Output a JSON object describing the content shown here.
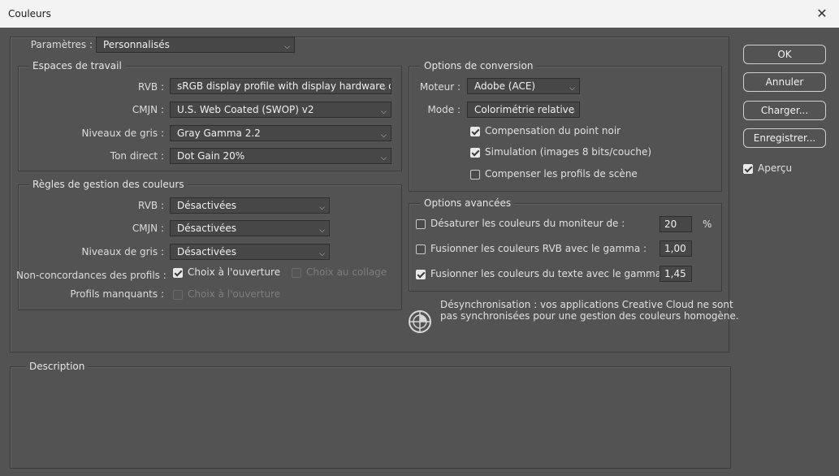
{
  "window": {
    "title": "Couleurs",
    "close_icon": "close-icon"
  },
  "settings": {
    "label": "Paramètres :",
    "value": "Personnalisés"
  },
  "workspaces": {
    "legend": "Espaces de travail",
    "rows": [
      {
        "label": "RVB :",
        "value": "sRGB display profile with display hardware c..."
      },
      {
        "label": "CMJN :",
        "value": "U.S. Web Coated (SWOP) v2"
      },
      {
        "label": "Niveaux de gris :",
        "value": "Gray Gamma 2.2"
      },
      {
        "label": "Ton direct :",
        "value": "Dot Gain 20%"
      }
    ]
  },
  "policies": {
    "legend": "Règles de gestion des couleurs",
    "rows": [
      {
        "label": "RVB :",
        "value": "Désactivées"
      },
      {
        "label": "CMJN :",
        "value": "Désactivées"
      },
      {
        "label": "Niveaux de gris :",
        "value": "Désactivées"
      }
    ],
    "mismatch_label": "Non-concordances des profils :",
    "mismatch_open": {
      "label": "Choix à l'ouverture",
      "checked": true
    },
    "mismatch_paste": {
      "label": "Choix au collage",
      "checked": false,
      "disabled": true
    },
    "missing_label": "Profils manquants :",
    "missing_open": {
      "label": "Choix à l'ouverture",
      "checked": false,
      "disabled": true
    }
  },
  "conversion": {
    "legend": "Options de conversion",
    "engine_label": "Moteur :",
    "engine_value": "Adobe (ACE)",
    "intent_label": "Mode :",
    "intent_value": "Colorimétrie relative",
    "black_point": {
      "label": "Compensation du point noir",
      "checked": true
    },
    "dither": {
      "label": "Simulation (images 8 bits/couche)",
      "checked": true
    },
    "scene_profiles": {
      "label": "Compenser les profils de scène",
      "checked": false
    }
  },
  "advanced": {
    "legend": "Options avancées",
    "desaturate": {
      "label": "Désaturer les couleurs du moniteur de :",
      "value": "20",
      "unit": "%",
      "checked": false
    },
    "blend_rgb": {
      "label": "Fusionner les couleurs RVB avec le gamma :",
      "value": "1,00",
      "checked": false
    },
    "blend_text": {
      "label": "Fusionner les couleurs du texte avec le gamma :",
      "value": "1,45",
      "checked": true
    }
  },
  "sync_message": {
    "line1": "Désynchronisation : vos applications Creative Cloud ne sont",
    "line2": "pas synchronisées pour une gestion des couleurs homogène.",
    "icon": "sync-status-icon"
  },
  "description": {
    "legend": "Description"
  },
  "buttons": {
    "ok": "OK",
    "cancel": "Annuler",
    "load": "Charger...",
    "save": "Enregistrer..."
  },
  "preview": {
    "label": "Aperçu",
    "checked": true
  }
}
